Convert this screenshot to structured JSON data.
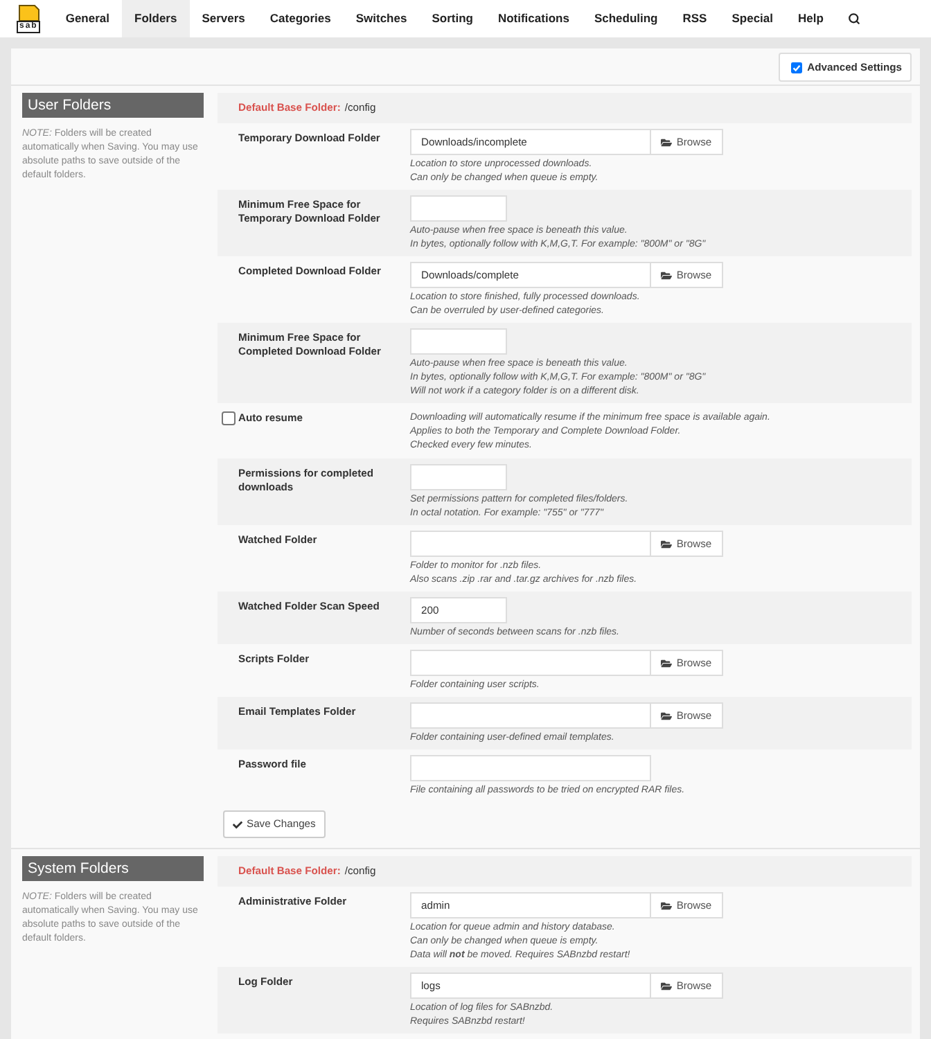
{
  "nav": {
    "logo_text": "sab",
    "tabs": [
      {
        "label": "General",
        "selected": false
      },
      {
        "label": "Folders",
        "selected": true
      },
      {
        "label": "Servers",
        "selected": false
      },
      {
        "label": "Categories",
        "selected": false
      },
      {
        "label": "Switches",
        "selected": false
      },
      {
        "label": "Sorting",
        "selected": false
      },
      {
        "label": "Notifications",
        "selected": false
      },
      {
        "label": "Scheduling",
        "selected": false
      },
      {
        "label": "RSS",
        "selected": false
      },
      {
        "label": "Special",
        "selected": false
      },
      {
        "label": "Help",
        "selected": false
      }
    ]
  },
  "advanced_settings": {
    "label": "Advanced Settings",
    "checked": true
  },
  "sections": [
    {
      "title": "User Folders",
      "note": "*NOTE:* Folders will be created automatically when Saving. You may use absolute paths to save outside of the default folders.",
      "base_folder": {
        "label": "Default Base Folder:",
        "value": "/config"
      },
      "fields": [
        {
          "kind": "folder",
          "label": "Temporary Download Folder",
          "value": "Downloads/incomplete",
          "browse": "Browse",
          "hints": [
            "Location to store unprocessed downloads.",
            "Can only be changed when queue is empty."
          ]
        },
        {
          "kind": "short",
          "label": "Minimum Free Space for Temporary Download Folder",
          "hints": [
            "Auto-pause when free space is beneath this value.",
            "In bytes, optionally follow with K,M,G,T. For example: \"800M\" or \"8G\""
          ]
        },
        {
          "kind": "folder",
          "label": "Completed Download Folder",
          "value": "Downloads/complete",
          "browse": "Browse",
          "hints": [
            "Location to store finished, fully processed downloads.",
            "Can be overruled by user-defined categories."
          ]
        },
        {
          "kind": "short",
          "label": "Minimum Free Space for Completed Download Folder",
          "hints": [
            "Auto-pause when free space is beneath this value.",
            "In bytes, optionally follow with K,M,G,T. For example: \"800M\" or \"8G\"",
            "Will not work if a category folder is on a different disk."
          ]
        },
        {
          "kind": "checkbox",
          "label": "Auto resume",
          "checked": false,
          "hints": [
            "Downloading will automatically resume if the minimum free space is available again.",
            "Applies to both the Temporary and Complete Download Folder.",
            "Checked every few minutes."
          ]
        },
        {
          "kind": "short",
          "label": "Permissions for completed downloads",
          "hints": [
            "Set permissions pattern for completed files/folders.",
            "In octal notation. For example: \"755\" or \"777\""
          ]
        },
        {
          "kind": "folder",
          "label": "Watched Folder",
          "browse": "Browse",
          "hints": [
            "Folder to monitor for .nzb files.",
            "Also scans .zip .rar and .tar.gz archives for .nzb files."
          ]
        },
        {
          "kind": "short",
          "label": "Watched Folder Scan Speed",
          "value": "200",
          "hints": [
            "Number of seconds between scans for .nzb files."
          ]
        },
        {
          "kind": "folder",
          "label": "Scripts Folder",
          "browse": "Browse",
          "hints": [
            "Folder containing user scripts."
          ]
        },
        {
          "kind": "folder",
          "label": "Email Templates Folder",
          "browse": "Browse",
          "hints": [
            "Folder containing user-defined email templates."
          ]
        },
        {
          "kind": "long",
          "label": "Password file",
          "hints": [
            "File containing all passwords to be tried on encrypted RAR files."
          ]
        }
      ],
      "save_button": "Save Changes"
    },
    {
      "title": "System Folders",
      "note": "*NOTE:* Folders will be created automatically when Saving. You may use absolute paths to save outside of the default folders.",
      "base_folder": {
        "label": "Default Base Folder:",
        "value": "/config"
      },
      "fields": [
        {
          "kind": "folder",
          "label": "Administrative Folder",
          "value": "admin",
          "browse": "Browse",
          "hints": [
            "Location for queue admin and history database.",
            "Can only be changed when queue is empty.",
            "Data will **not** be moved. Requires SABnzbd restart!"
          ]
        },
        {
          "kind": "folder",
          "label": "Log Folder",
          "value": "logs",
          "browse": "Browse",
          "hints": [
            "Location of log files for SABnzbd.",
            "Requires SABnzbd restart!"
          ]
        }
      ]
    }
  ]
}
